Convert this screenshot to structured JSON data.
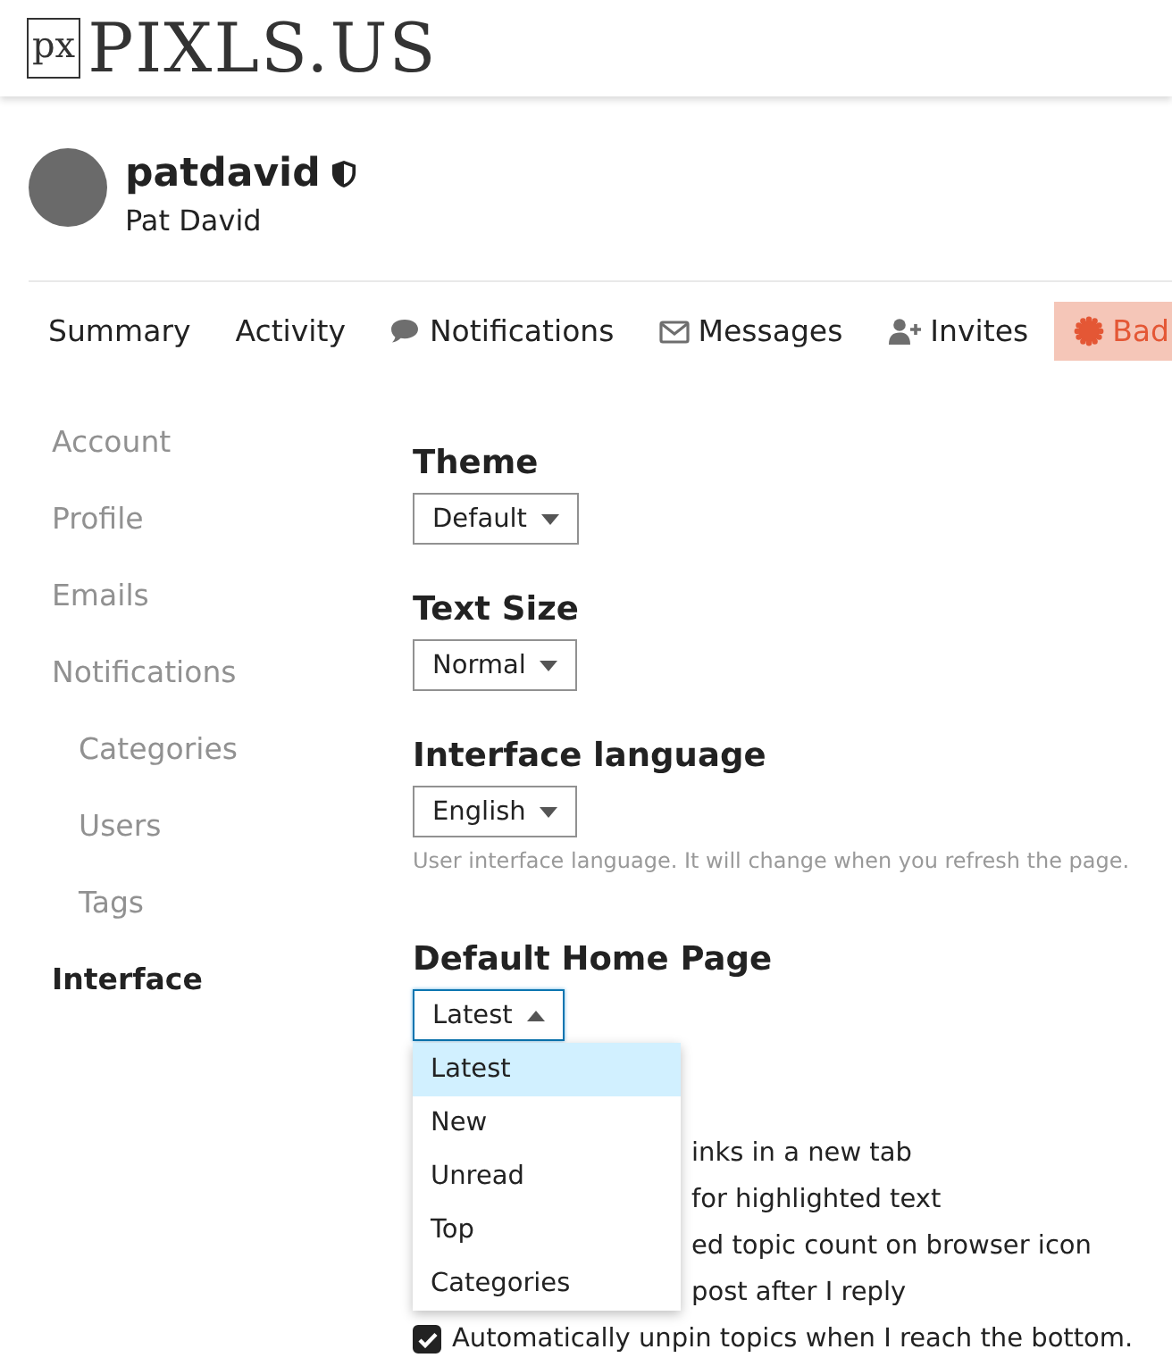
{
  "header": {
    "logo_mark": "px",
    "logo_text": "PIXLS.US"
  },
  "profile": {
    "username": "patdavid",
    "full_name": "Pat David"
  },
  "nav_tabs": [
    {
      "label": "Summary",
      "selected": false
    },
    {
      "label": "Activity",
      "selected": false
    },
    {
      "label": "Notifications",
      "selected": false
    },
    {
      "label": "Messages",
      "selected": false
    },
    {
      "label": "Invites",
      "selected": false
    },
    {
      "label": "Bad",
      "selected": true
    }
  ],
  "sidebar": {
    "items": [
      {
        "label": "Account",
        "selected": false
      },
      {
        "label": "Profile",
        "selected": false
      },
      {
        "label": "Emails",
        "selected": false
      },
      {
        "label": "Notifications",
        "selected": false,
        "children": [
          {
            "label": "Categories",
            "selected": false
          },
          {
            "label": "Users",
            "selected": false
          },
          {
            "label": "Tags",
            "selected": false
          }
        ]
      },
      {
        "label": "Interface",
        "selected": true
      }
    ]
  },
  "settings": [
    {
      "heading": "Theme",
      "value": "Default",
      "expanded": false
    },
    {
      "heading": "Text Size",
      "value": "Normal",
      "expanded": false
    },
    {
      "heading": "Interface language",
      "value": "English",
      "expanded": false,
      "hint": "User interface language. It will change when you refresh the page."
    },
    {
      "heading": "Default Home Page",
      "value": "Latest",
      "expanded": true,
      "options": [
        {
          "label": "Latest",
          "selected": true
        },
        {
          "label": "New",
          "selected": false
        },
        {
          "label": "Unread",
          "selected": false
        },
        {
          "label": "Top",
          "selected": false
        },
        {
          "label": "Categories",
          "selected": false
        }
      ]
    }
  ],
  "options": [
    {
      "kind": "covered",
      "label": "inks in a new tab"
    },
    {
      "kind": "covered",
      "label": "for highlighted text"
    },
    {
      "kind": "covered",
      "label": "ed topic count on browser icon"
    },
    {
      "kind": "covered",
      "label": "post after I reply"
    },
    {
      "kind": "checkbox",
      "label": "Automatically unpin topics when I reach the bottom.",
      "checked": true
    }
  ]
}
